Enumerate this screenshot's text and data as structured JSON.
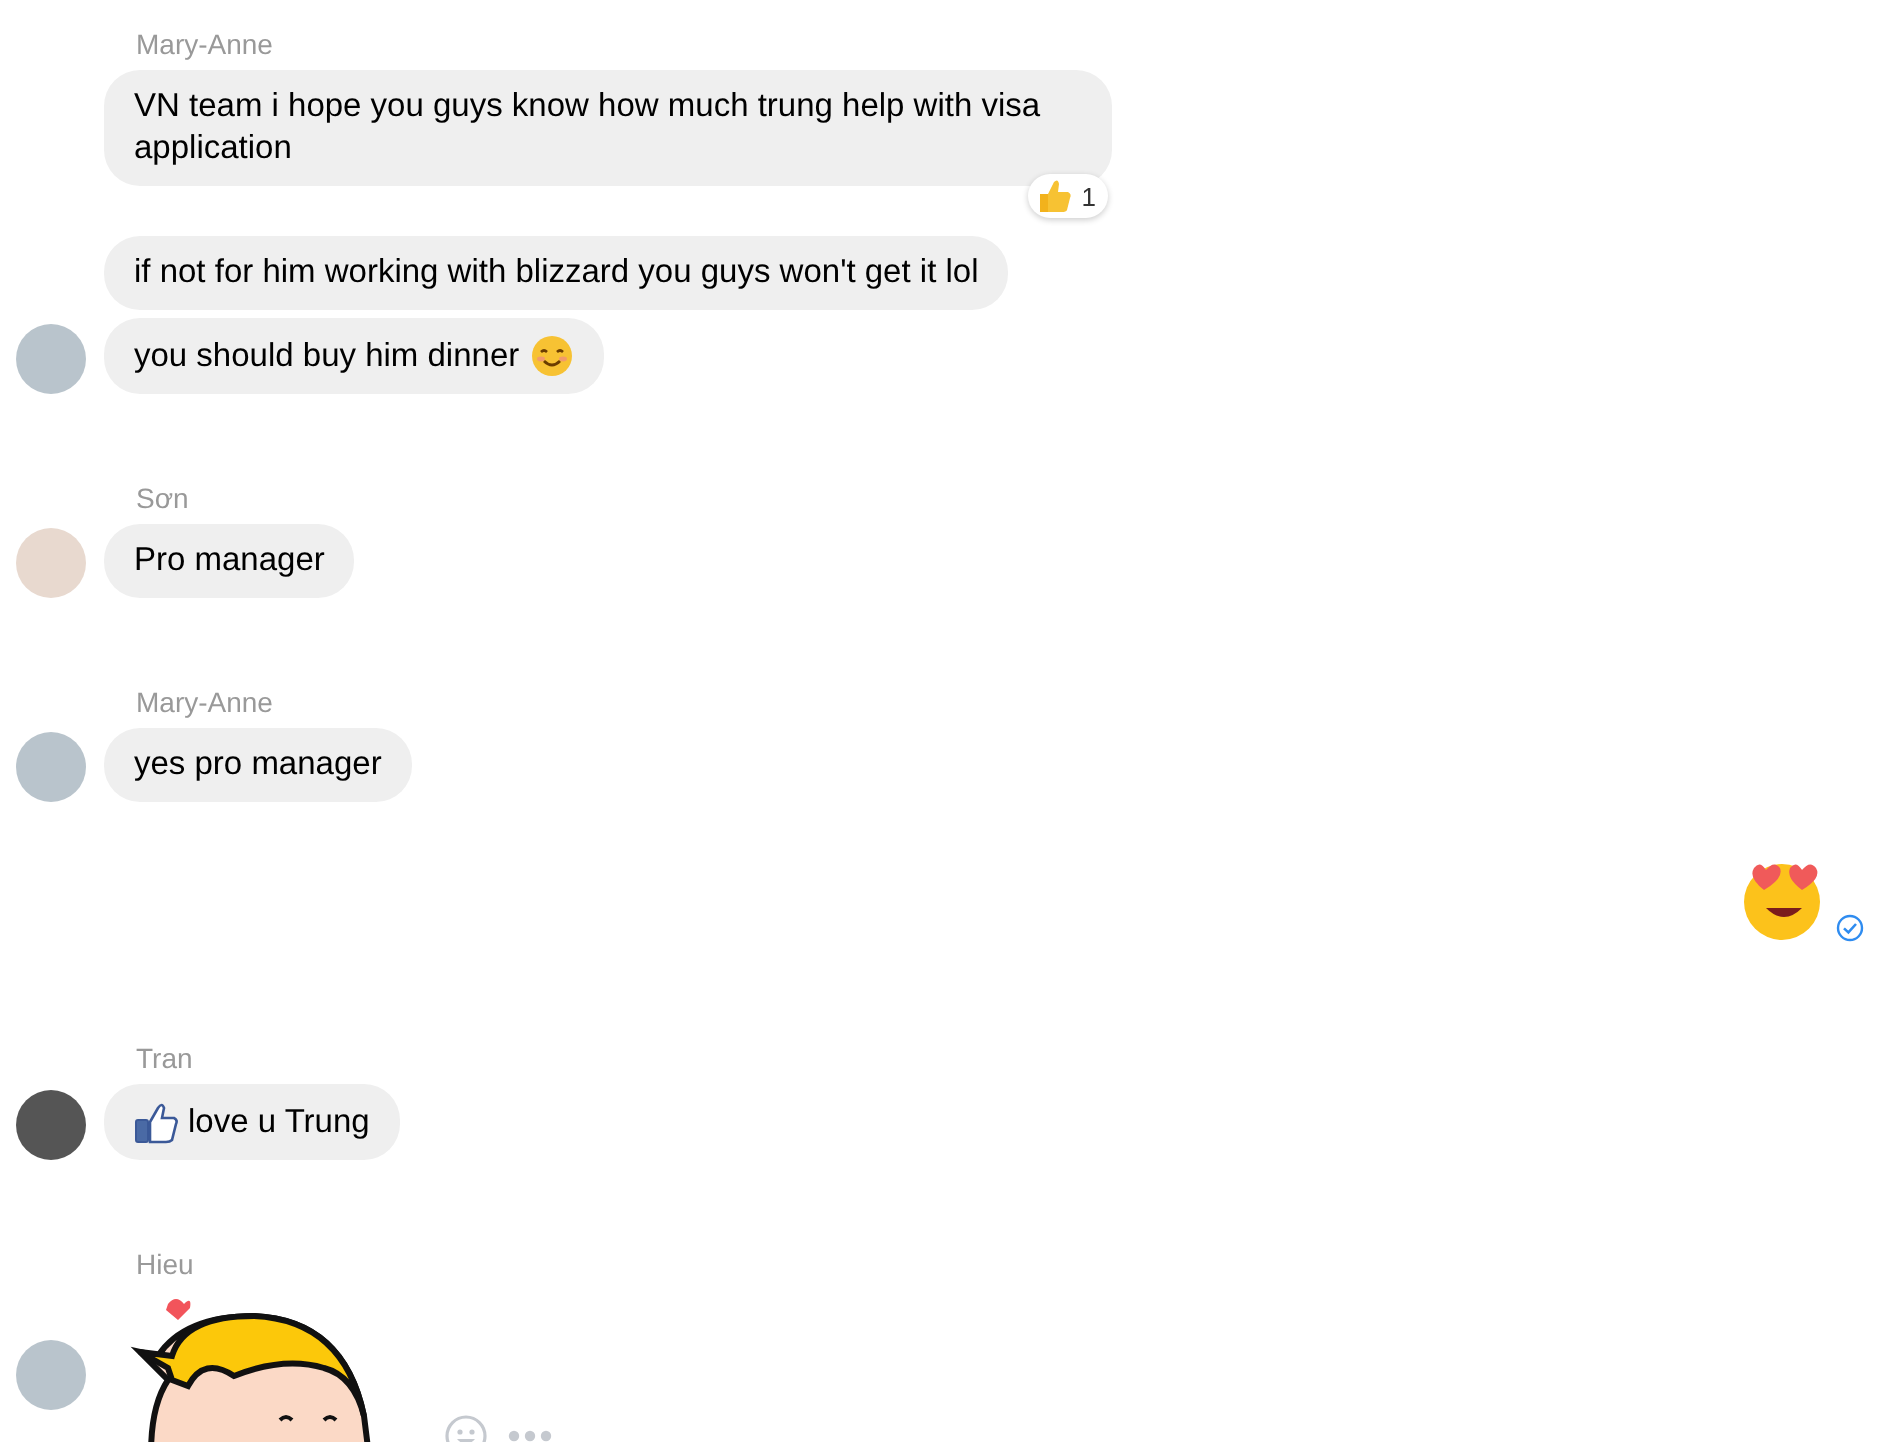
{
  "groups": [
    {
      "kind": "incoming",
      "sender": "Mary-Anne",
      "messages": [
        {
          "kind": "text",
          "text": "VN team i hope you guys know how much trung help with visa application",
          "reaction": {
            "count": "1"
          }
        },
        {
          "kind": "text",
          "text": "if not for him working with blizzard you guys won't get it lol"
        },
        {
          "kind": "text-smile",
          "text": "you should buy him dinner"
        }
      ]
    },
    {
      "kind": "incoming",
      "sender": "Sơn",
      "messages": [
        {
          "kind": "text",
          "text": "Pro manager"
        }
      ]
    },
    {
      "kind": "incoming",
      "sender": "Mary-Anne",
      "messages": [
        {
          "kind": "text",
          "text": "yes pro manager"
        }
      ]
    },
    {
      "kind": "outgoing",
      "messages": [
        {
          "kind": "heart-eyes"
        }
      ]
    },
    {
      "kind": "incoming",
      "sender": "Tran",
      "messages": [
        {
          "kind": "text-like",
          "text": "love u Trung"
        }
      ]
    },
    {
      "kind": "incoming",
      "sender": "Hieu",
      "messages": [
        {
          "kind": "sticker"
        }
      ]
    }
  ]
}
